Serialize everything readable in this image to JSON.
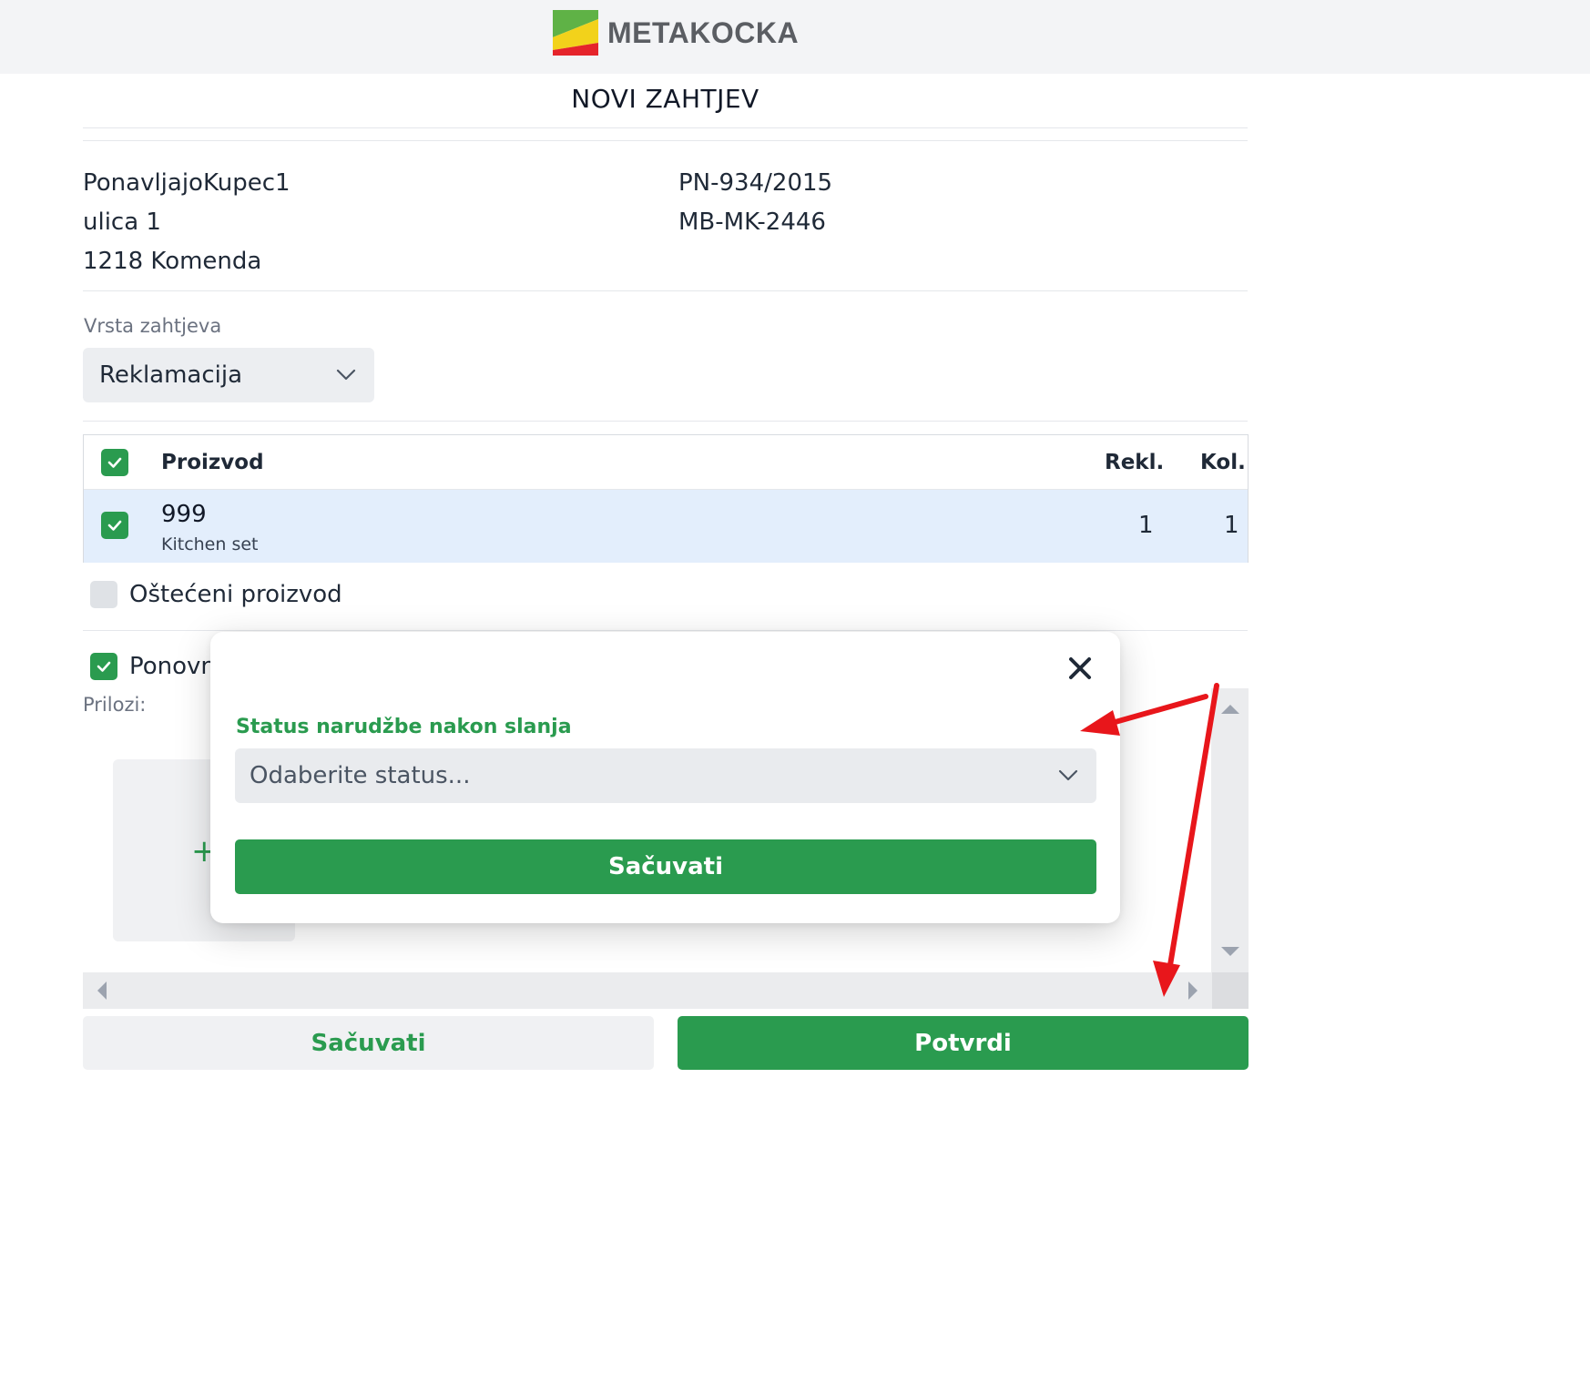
{
  "header": {
    "logo_text": "METAKOCKA",
    "logo_icon": "metakocka-logo-icon"
  },
  "page": {
    "title": "NOVI ZAHTJEV"
  },
  "customer": {
    "name": "PonavljajoKupec1",
    "street": "ulica 1",
    "city": "1218 Komenda"
  },
  "documents": {
    "doc1": "PN-934/2015",
    "doc2": "MB-MK-2446"
  },
  "request_type": {
    "label": "Vrsta zahtjeva",
    "selected": "Reklamacija"
  },
  "table": {
    "headers": {
      "product": "Proizvod",
      "rekl": "Rekl.",
      "kol": "Kol."
    },
    "header_checked": true,
    "rows": [
      {
        "code": "999",
        "name": "Kitchen set",
        "rekl": "1",
        "kol": "1",
        "checked": true
      }
    ]
  },
  "options": {
    "damaged_label": "Oštećeni proizvod",
    "damaged_checked": false,
    "repeat_label_visible": "Ponovn",
    "repeat_checked": true
  },
  "attachments": {
    "label": "Prilozi:",
    "add_icon": "plus-icon"
  },
  "buttons": {
    "save": "Sačuvati",
    "confirm": "Potvrdi"
  },
  "modal": {
    "label": "Status narudžbe nakon slanja",
    "select_placeholder": "Odaberite status...",
    "save_button": "Sačuvati",
    "close_icon": "close-icon"
  },
  "colors": {
    "primary_green": "#2a9b4f",
    "annotation_red": "#e8161b",
    "row_highlight": "#e3eefc"
  }
}
